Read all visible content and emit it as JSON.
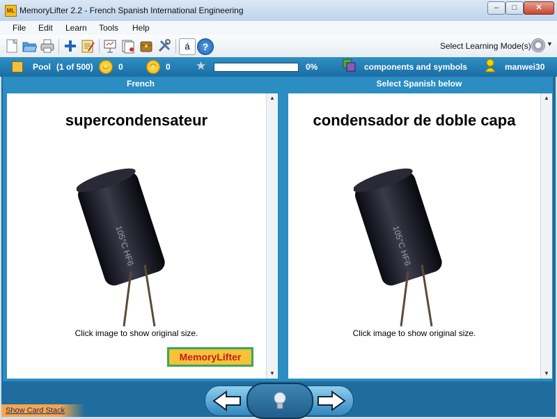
{
  "window": {
    "app_icon_text": "ML",
    "title": "MemoryLifter 2.2 - French Spanish International Engineering",
    "min_label": "–",
    "max_label": "□",
    "close_label": "✕"
  },
  "menu": [
    "File",
    "Edit",
    "Learn",
    "Tools",
    "Help"
  ],
  "toolbar": {
    "icons": [
      "new-file-icon",
      "open-folder-icon",
      "print-icon",
      "add-icon",
      "edit-notepad-icon",
      "presentation-icon",
      "card-stack-icon",
      "chest-icon",
      "tools-icon",
      "accent-character-icon",
      "help-icon"
    ],
    "accent_glyph": "á",
    "help_glyph": "?",
    "mode_label": "Select Learning Mode(s)"
  },
  "status": {
    "pool_label": "Pool",
    "pool_count": "(1 of 500)",
    "correct_count": "0",
    "wrong_count": "0",
    "progress_fraction": 0,
    "progress_text": "0%",
    "category": "components and symbols",
    "user": "manwei30"
  },
  "question": {
    "header": "French",
    "word": "supercondensateur",
    "hint": "Click image to show original size."
  },
  "answer": {
    "header": "Select Spanish below",
    "word": "condensador de doble capa",
    "hint": "Click image to show original size."
  },
  "logo": {
    "text": "MemoryLifter"
  },
  "bottom": {
    "show_card_stack": "Show Card Stack"
  }
}
